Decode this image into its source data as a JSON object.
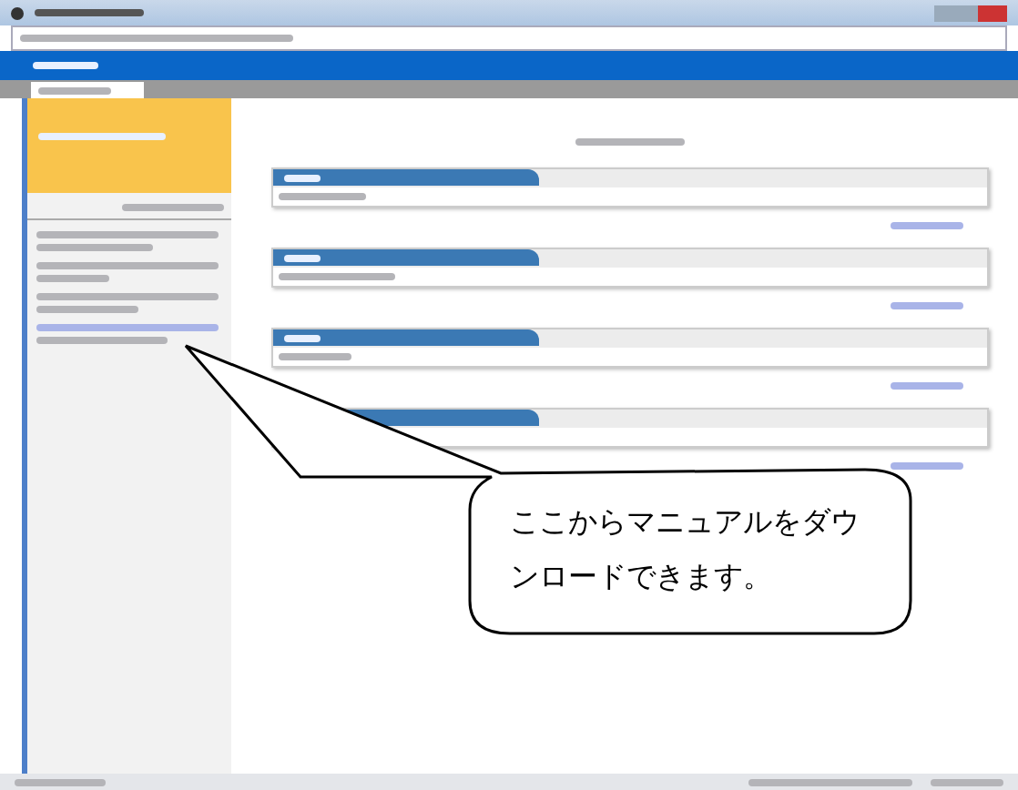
{
  "sidebar": {
    "items": [
      {
        "kind": "text"
      },
      {
        "kind": "text"
      },
      {
        "kind": "text"
      },
      {
        "kind": "link"
      }
    ]
  },
  "panels": [
    {
      "kind": "notice"
    },
    {
      "kind": "notice"
    },
    {
      "kind": "notice"
    },
    {
      "kind": "notice"
    }
  ],
  "callout": {
    "text": "ここからマニュアルをダウンロードできます。"
  }
}
